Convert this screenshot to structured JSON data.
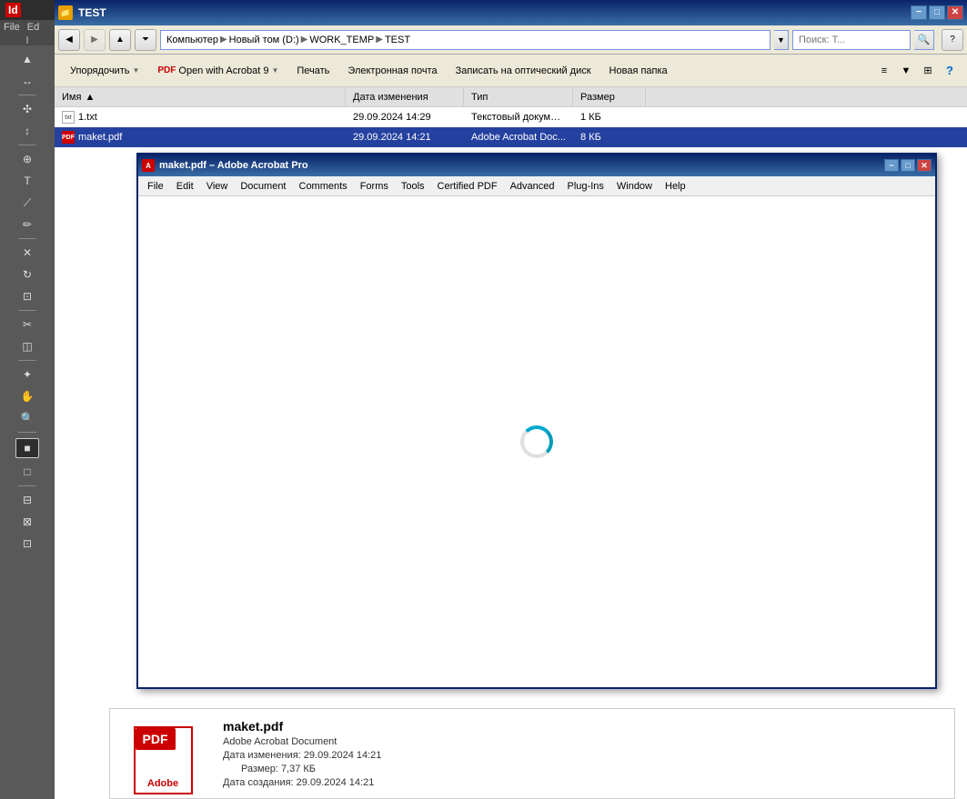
{
  "indesign": {
    "title": "Id",
    "menu": {
      "file": "File",
      "edit": "Ed"
    },
    "tools": [
      "▲",
      "↔",
      "✣",
      "↕",
      "⊕",
      "T",
      "⟋",
      "✏",
      "✕",
      "✉",
      "✂",
      "⊞",
      "⚡",
      "✱",
      "⊗",
      "☰",
      "△",
      "✦"
    ]
  },
  "explorer": {
    "title": "TEST",
    "address": {
      "parts": [
        "Компьютер",
        "Новый том (D:)",
        "WORK_TEMP",
        "TEST"
      ],
      "separator": "▶"
    },
    "search_placeholder": "Поиск: Т...",
    "toolbar": {
      "organize": "Упорядочить",
      "open_acrobat": "Open with Acrobat 9",
      "print": "Печать",
      "email": "Электронная почта",
      "burn": "Записать на оптический диск",
      "new_folder": "Новая папка"
    },
    "columns": {
      "name": "Имя",
      "date": "Дата изменения",
      "type": "Тип",
      "size": "Размер"
    },
    "files": [
      {
        "name": "1.txt",
        "date": "29.09.2024 14:29",
        "type": "Текстовый документ",
        "size": "1 КБ",
        "icon": "txt",
        "selected": false
      },
      {
        "name": "maket.pdf",
        "date": "29.09.2024 14:21",
        "type": "Adobe Acrobat Doc...",
        "size": "8 КБ",
        "icon": "pdf",
        "selected": true
      }
    ]
  },
  "acrobat": {
    "title": "maket.pdf – Adobe Acrobat Pro",
    "menu_items": [
      "File",
      "Edit",
      "View",
      "Document",
      "Comments",
      "Forms",
      "Tools",
      "Certified PDF",
      "Advanced",
      "Plug-Ins",
      "Window",
      "Help"
    ],
    "loading": true
  },
  "file_info": {
    "filename": "maket.pdf",
    "type": "Adobe Acrobat Document",
    "date_modified_label": "Дата изменения:",
    "date_modified": "29.09.2024 14:21",
    "size_label": "Размер:",
    "size": "7,37 КБ",
    "date_created_label": "Дата создания:",
    "date_created": "29.09.2024 14:21",
    "adobe_label": "Adobe"
  }
}
